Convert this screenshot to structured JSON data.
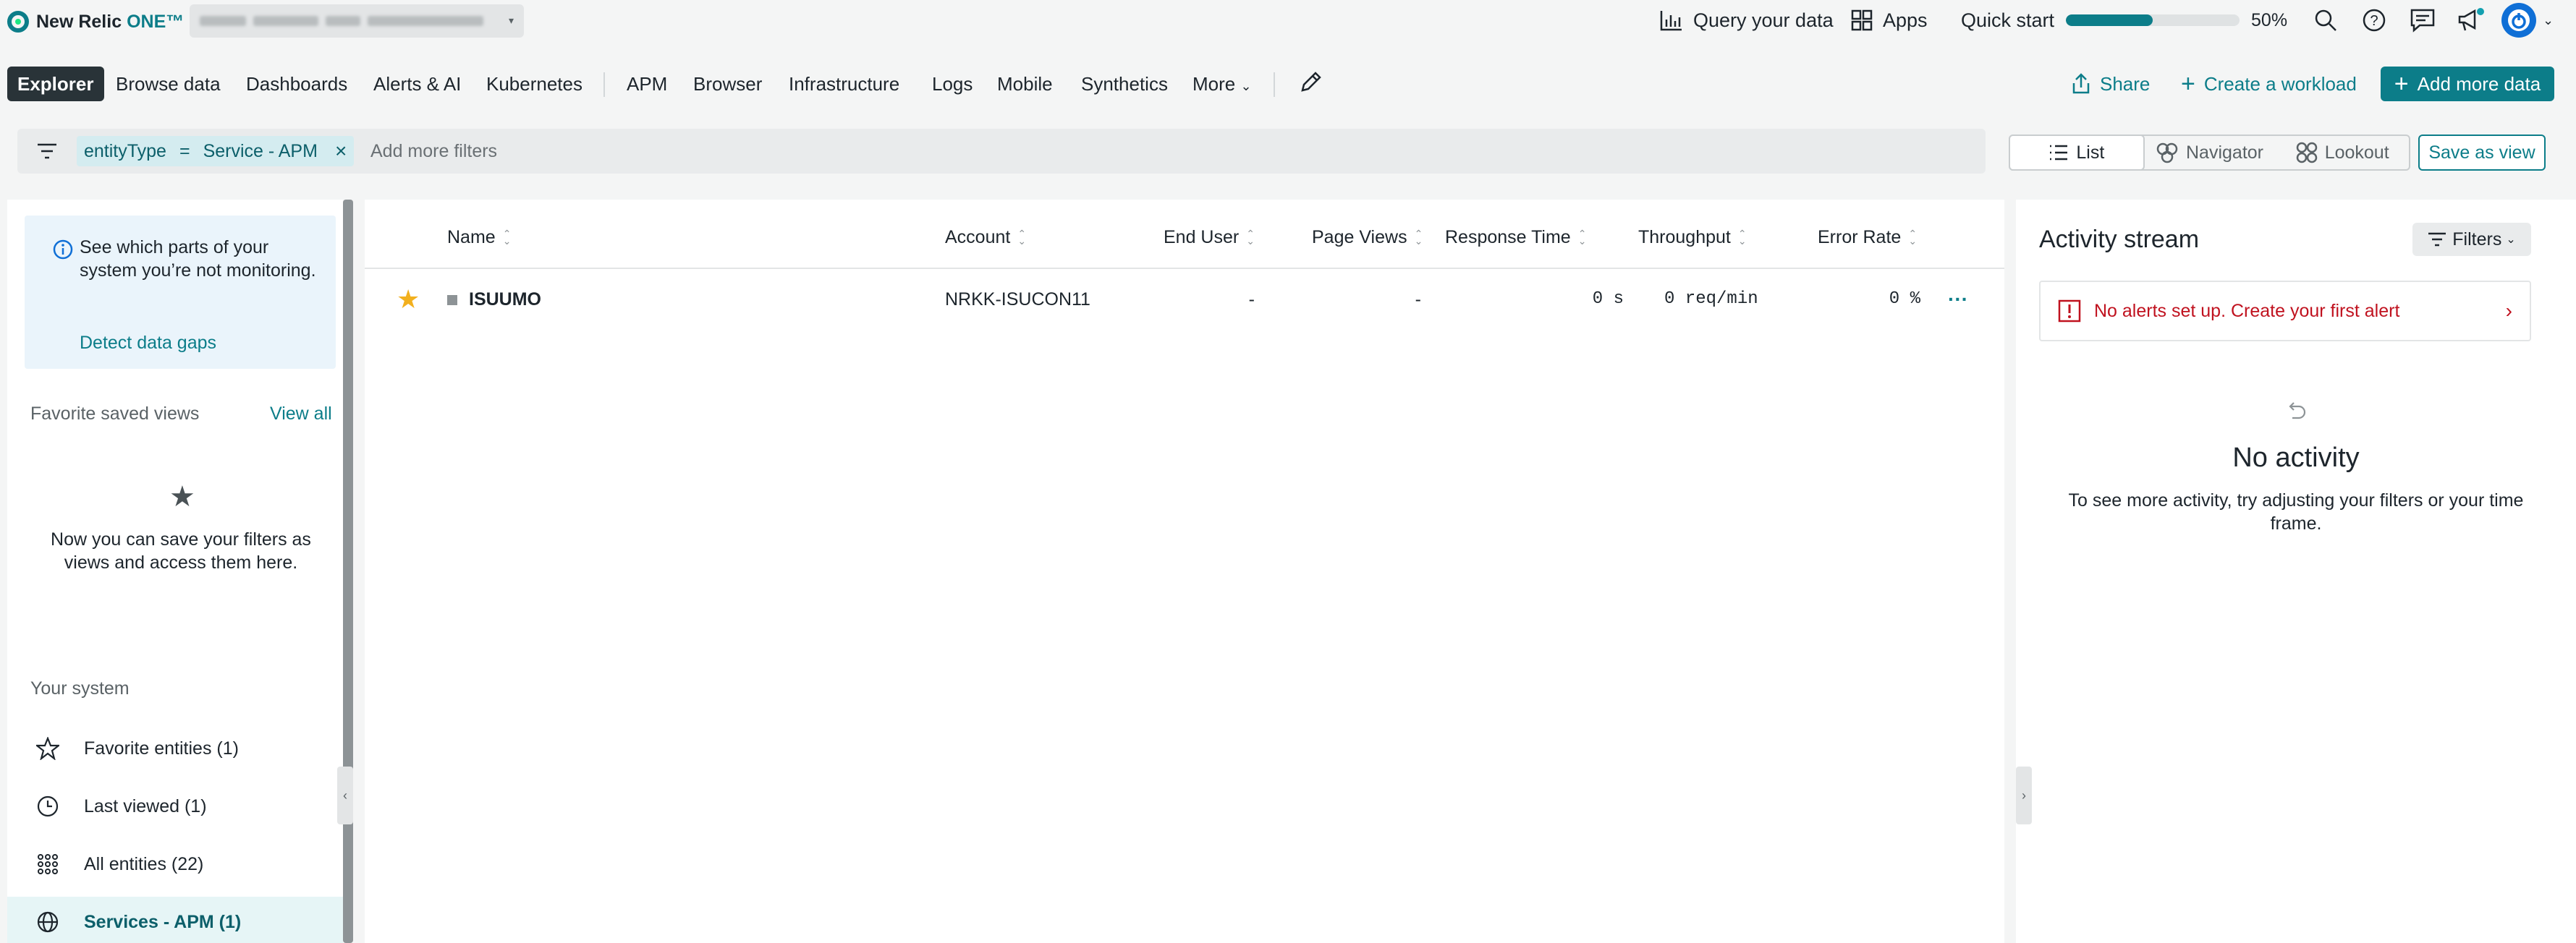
{
  "app": {
    "logo_name": "New Relic",
    "logo_suffix": "ONE™"
  },
  "topbar": {
    "query_label": "Query your data",
    "apps_label": "Apps",
    "quickstart_label": "Quick start",
    "quickstart_progress_value": 50,
    "quickstart_percent": "50%"
  },
  "nav": {
    "items": [
      "Explorer",
      "Browse data",
      "Dashboards",
      "Alerts & AI",
      "Kubernetes",
      "APM",
      "Browser",
      "Infrastructure",
      "Logs",
      "Mobile",
      "Synthetics",
      "More"
    ],
    "share": "Share",
    "create_workload": "Create a workload",
    "add_more_data": "Add more data"
  },
  "filter": {
    "key": "entityType",
    "operator": "=",
    "value": "Service - APM",
    "remove": "×",
    "placeholder": "Add more filters"
  },
  "views": {
    "list": "List",
    "navigator": "Navigator",
    "lookout": "Lookout",
    "save": "Save as view"
  },
  "left": {
    "info_text": "See which parts of your system you’re not monitoring.",
    "info_link": "Detect data gaps",
    "fav_heading": "Favorite saved views",
    "view_all": "View all",
    "empty_note": "Now you can save your filters as views and access them here.",
    "system_heading": "Your system",
    "items": [
      {
        "label": "Favorite entities (1)",
        "icon": "star-outline-icon"
      },
      {
        "label": "Last viewed (1)",
        "icon": "clock-icon"
      },
      {
        "label": "All entities (22)",
        "icon": "grid-icon"
      },
      {
        "label": "Services - APM (1)",
        "icon": "globe-icon"
      }
    ]
  },
  "table": {
    "columns": [
      "Name",
      "Account",
      "End User",
      "Page Views",
      "Response Time",
      "Throughput",
      "Error Rate"
    ],
    "rows": [
      {
        "name": "ISUUMO",
        "account": "NRKK-ISUCON11",
        "end_user": "-",
        "page_views": "-",
        "response_time": "0 s",
        "throughput": "0 req/min",
        "error_rate": "0 %",
        "more": "···"
      }
    ]
  },
  "activity": {
    "title": "Activity stream",
    "filters": "Filters",
    "alert_text": "No alerts set up. Create your first alert",
    "no_activity_title": "No activity",
    "no_activity_desc": "To see more activity, try adjusting your filters or your time frame."
  },
  "colors": {
    "brand": "#0c7d89",
    "alert": "#c0121f",
    "favorite": "#f2b01e"
  }
}
